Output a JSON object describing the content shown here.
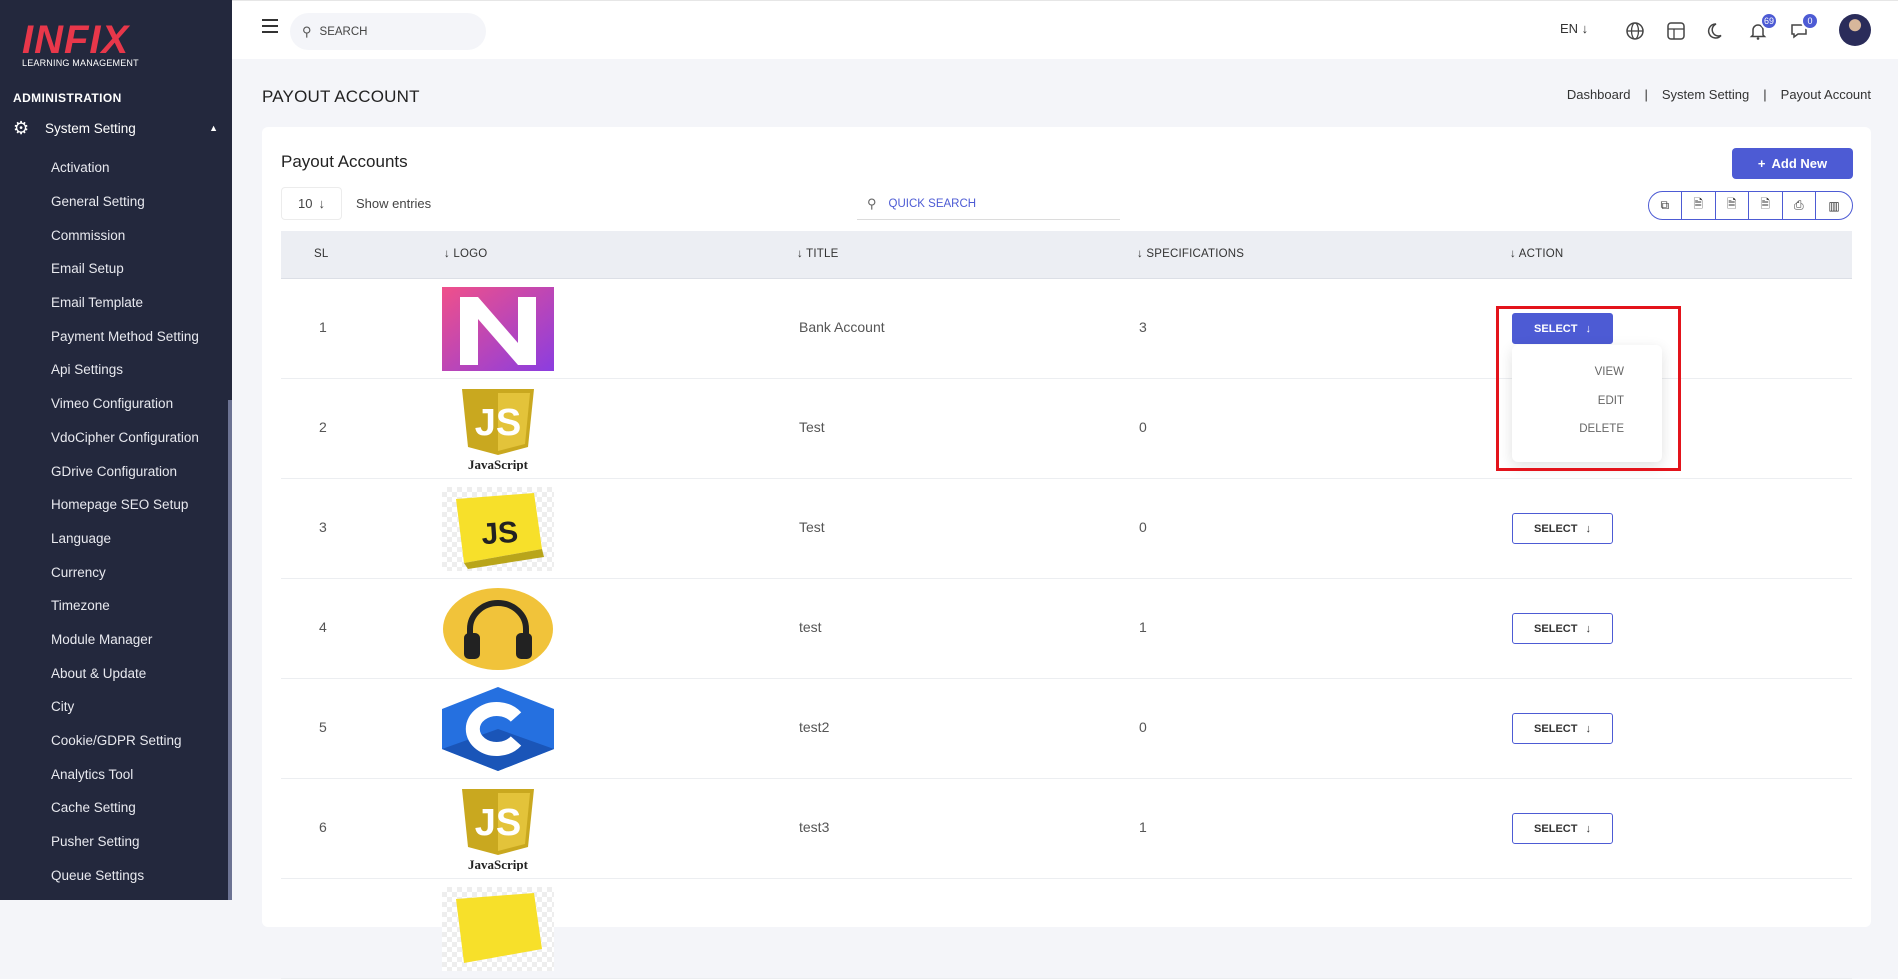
{
  "sidebar": {
    "logo_text": "INFIX",
    "logo_tagline": "LEARNING MANAGEMENT",
    "section_label": "ADMINISTRATION",
    "parent_label": "System Setting",
    "items": [
      {
        "label": "Activation"
      },
      {
        "label": "General Setting"
      },
      {
        "label": "Commission"
      },
      {
        "label": "Email Setup"
      },
      {
        "label": "Email Template"
      },
      {
        "label": "Payment Method Setting"
      },
      {
        "label": "Api Settings"
      },
      {
        "label": "Vimeo Configuration"
      },
      {
        "label": "VdoCipher Configuration"
      },
      {
        "label": "GDrive Configuration"
      },
      {
        "label": "Homepage SEO Setup"
      },
      {
        "label": "Language"
      },
      {
        "label": "Currency"
      },
      {
        "label": "Timezone"
      },
      {
        "label": "Module Manager"
      },
      {
        "label": "About & Update"
      },
      {
        "label": "City"
      },
      {
        "label": "Cookie/GDPR Setting"
      },
      {
        "label": "Analytics Tool"
      },
      {
        "label": "Cache Setting"
      },
      {
        "label": "Pusher Setting"
      },
      {
        "label": "Queue Settings"
      }
    ]
  },
  "topbar": {
    "search_placeholder": "SEARCH",
    "language": "EN ↓",
    "notifications_count": "69",
    "messages_count": "0"
  },
  "page": {
    "title": "PAYOUT ACCOUNT",
    "breadcrumb": [
      "Dashboard",
      "|",
      "System Setting",
      "|",
      "Payout Account"
    ]
  },
  "card": {
    "title": "Payout Accounts",
    "add_label": "Add New",
    "entries_value": "10",
    "entries_label": "Show entries",
    "quick_search_placeholder": "QUICK SEARCH"
  },
  "table": {
    "headers": [
      "SL",
      "LOGO",
      "TITLE",
      "SPECIFICATIONS",
      "ACTION"
    ],
    "rows": [
      {
        "sl": "1",
        "title": "Bank Account",
        "spec": "3",
        "logo": "n-logo"
      },
      {
        "sl": "2",
        "title": "Test",
        "spec": "0",
        "logo": "javascript-logo"
      },
      {
        "sl": "3",
        "title": "Test",
        "spec": "0",
        "logo": "js-3d-logo"
      },
      {
        "sl": "4",
        "title": "test",
        "spec": "1",
        "logo": "headphones-logo"
      },
      {
        "sl": "5",
        "title": "test2",
        "spec": "0",
        "logo": "c-logo"
      },
      {
        "sl": "6",
        "title": "test3",
        "spec": "1",
        "logo": "javascript-logo"
      }
    ],
    "select_label": "SELECT",
    "js_caption": "JavaScript"
  },
  "menu": {
    "items": [
      "VIEW",
      "EDIT",
      "DELETE"
    ]
  },
  "colors": {
    "accent": "#4d5bd4",
    "sidebar_bg": "#23283d",
    "brand_red": "#e8374a",
    "highlight": "#e3131b"
  }
}
